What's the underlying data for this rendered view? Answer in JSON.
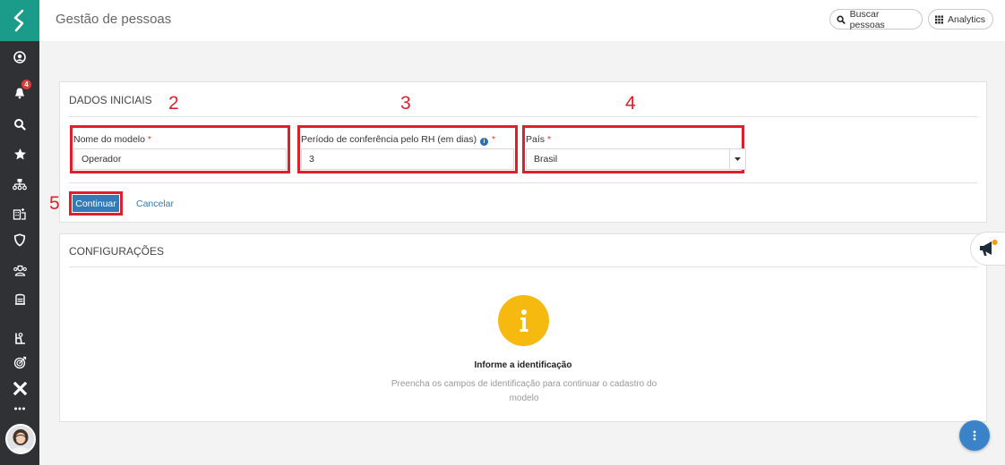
{
  "header": {
    "title": "Gestão de pessoas",
    "search_button": "Buscar pessoas",
    "analytics_button": "Analytics"
  },
  "sidebar": {
    "notification_count": "4",
    "icons": [
      "user-circle-icon",
      "bell-icon",
      "search-icon",
      "star-icon",
      "org-chart-icon",
      "building-icon",
      "shield-icon",
      "team-icon",
      "briefcase-icon",
      "person-desk-icon",
      "target-icon",
      "x-icon",
      "more-icon"
    ]
  },
  "form": {
    "section_title": "DADOS INICIAIS",
    "fields": [
      {
        "label": "Nome do modelo",
        "required": "*",
        "value": "Operador"
      },
      {
        "label": "Período de conferência pelo RH (em dias)",
        "required": "*",
        "value": "3"
      },
      {
        "label": "País",
        "required": "*",
        "value": "Brasil"
      }
    ],
    "submit_label": "Continuar",
    "cancel_label": "Cancelar"
  },
  "annotations": [
    "2",
    "3",
    "4",
    "5"
  ],
  "config": {
    "section_title": "CONFIGURAÇÕES",
    "empty_title": "Informe a identificação",
    "empty_desc": "Preencha os campos de identificação para continuar o cadastro do modelo"
  },
  "colors": {
    "sidebar": "#2f3135",
    "brand": "#1b9c8a",
    "primary": "#337ab7",
    "annotation": "#e01f2d",
    "info": "#f6b90f"
  }
}
